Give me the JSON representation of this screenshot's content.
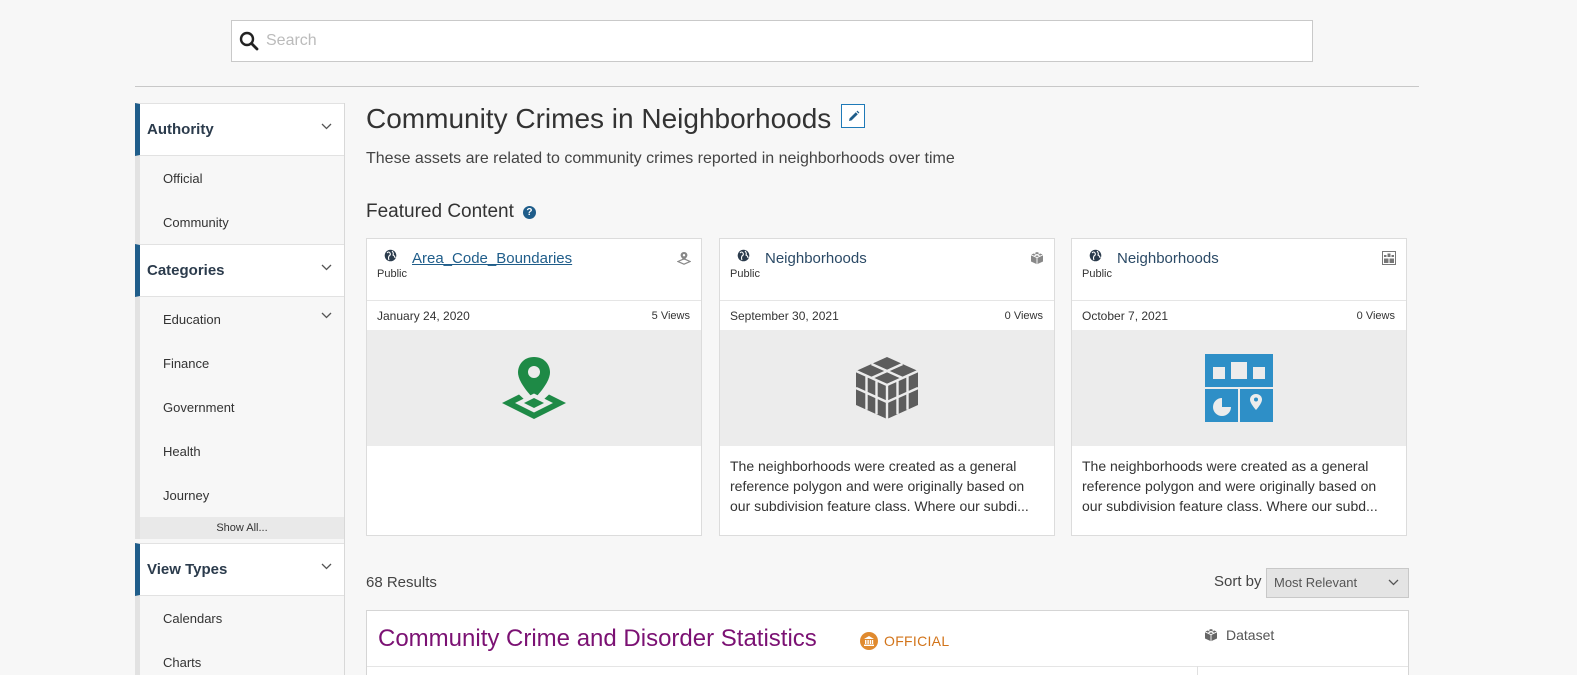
{
  "search": {
    "placeholder": "Search"
  },
  "sidebar": {
    "authority": {
      "title": "Authority",
      "items": [
        "Official",
        "Community"
      ]
    },
    "categories": {
      "title": "Categories",
      "items": [
        "Education",
        "Finance",
        "Government",
        "Health",
        "Journey"
      ],
      "show_all": "Show All..."
    },
    "view_types": {
      "title": "View Types",
      "items": [
        "Calendars",
        "Charts"
      ]
    }
  },
  "main": {
    "title": "Community Crimes in Neighborhoods",
    "description": "These assets are related to community crimes reported in neighborhoods over time",
    "featured_title": "Featured Content",
    "cards": [
      {
        "title": "Area_Code_Boundaries",
        "access": "Public",
        "date": "January 24, 2020",
        "views": "5 Views",
        "description": "",
        "thumb_icon": "map-pin-icon",
        "type_icon": "map-icon",
        "accent": "#1e8a46"
      },
      {
        "title": "Neighborhoods",
        "access": "Public",
        "date": "September 30, 2021",
        "views": "0 Views",
        "description": "The neighborhoods were created as a general reference polygon and were originally based on our subdivision feature class. Where our subdi...",
        "thumb_icon": "cube-stack-icon",
        "type_icon": "cube-icon",
        "accent": "#5d5d5d"
      },
      {
        "title": "Neighborhoods",
        "access": "Public",
        "date": "October 7, 2021",
        "views": "0 Views",
        "description": "The neighborhoods were created as a general reference polygon and were originally based on our subdivision feature class.  Where our subd...",
        "thumb_icon": "data-lens-icon",
        "type_icon": "data-lens-small-icon",
        "accent": "#2e8fc7"
      }
    ],
    "results_count": "68 Results",
    "sort_label": "Sort by",
    "sort_value": "Most Relevant",
    "result": {
      "title": "Community Crime and Disorder Statistics",
      "badge": "OFFICIAL",
      "type": "Dataset"
    }
  },
  "colors": {
    "accent_border": "#1f5d8a",
    "result_title": "#7b1173",
    "official": "#d2741a"
  }
}
